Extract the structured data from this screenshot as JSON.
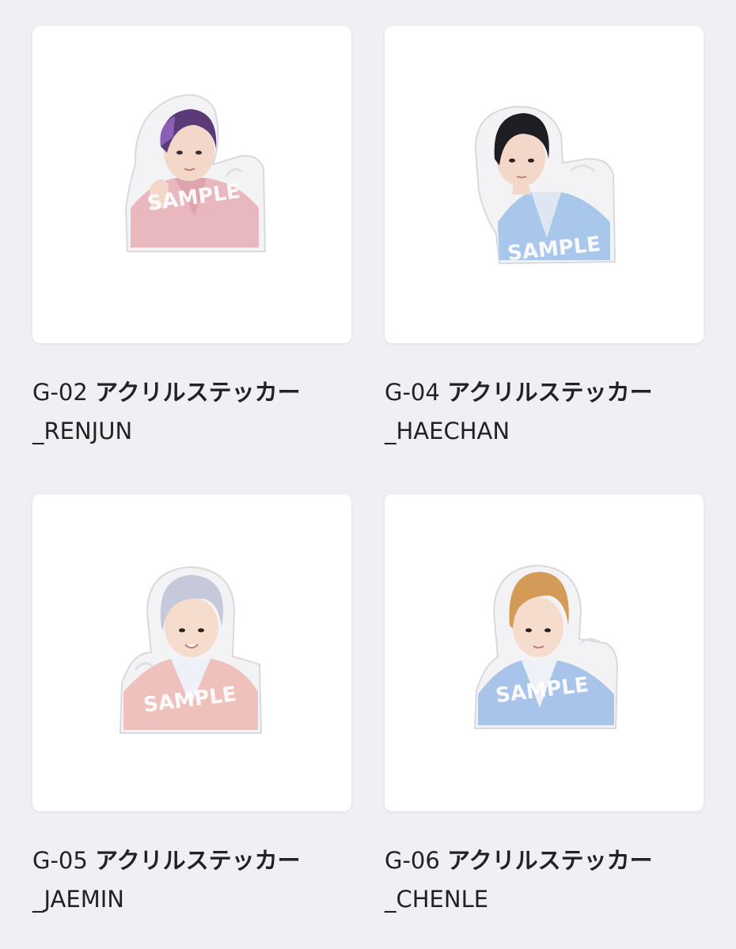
{
  "products": [
    {
      "code": "G-02",
      "name": "アクリルステッカー",
      "member": "_RENJUN",
      "watermark": "SAMPLE",
      "icon": "acrylic-sticker-photo",
      "hair_color": "#5b3a78",
      "jacket_color": "#e9b8bf",
      "backdrop_color": "#f4dfe2"
    },
    {
      "code": "G-04",
      "name": "アクリルステッカー",
      "member": "_HAECHAN",
      "watermark": "SAMPLE",
      "icon": "acrylic-sticker-photo",
      "hair_color": "#1f1d24",
      "jacket_color": "#a9c7ea",
      "backdrop_color": "#e6edf7"
    },
    {
      "code": "G-05",
      "name": "アクリルステッカー",
      "member": "_JAEMIN",
      "watermark": "SAMPLE",
      "icon": "acrylic-sticker-photo",
      "hair_color": "#c6c9d9",
      "jacket_color": "#efc1bd",
      "backdrop_color": "#f6e6e4"
    },
    {
      "code": "G-06",
      "name": "アクリルステッカー",
      "member": "_CHENLE",
      "watermark": "SAMPLE",
      "icon": "acrylic-sticker-photo",
      "hair_color": "#d39a58",
      "jacket_color": "#a8c4ea",
      "backdrop_color": "#e6edf7"
    }
  ]
}
